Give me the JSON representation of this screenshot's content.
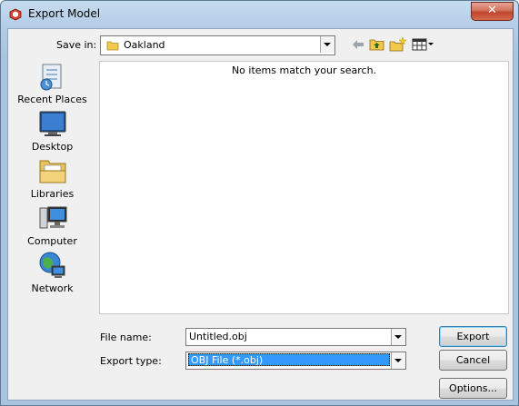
{
  "window": {
    "title": "Export Model",
    "close_glyph": "✕"
  },
  "save_in": {
    "label": "Save in:",
    "value": "Oakland"
  },
  "toolbar": {
    "back_icon": "back-arrow-icon",
    "up_icon": "up-folder-icon",
    "new_folder_icon": "new-folder-icon",
    "view_icon": "view-menu-icon"
  },
  "places": [
    {
      "label": "Recent Places",
      "icon": "recent-places-icon"
    },
    {
      "label": "Desktop",
      "icon": "desktop-icon"
    },
    {
      "label": "Libraries",
      "icon": "libraries-icon"
    },
    {
      "label": "Computer",
      "icon": "computer-icon"
    },
    {
      "label": "Network",
      "icon": "network-icon"
    }
  ],
  "file_list": {
    "empty_message": "No items match your search."
  },
  "file_name": {
    "label": "File name:",
    "value": "Untitled.obj"
  },
  "export_type": {
    "label": "Export type:",
    "value": "OBJ File (*.obj)"
  },
  "buttons": {
    "export": "Export",
    "cancel": "Cancel",
    "options": "Options..."
  },
  "colors": {
    "selection": "#3399ff",
    "close_button": "#c0452c",
    "title_bar": "#b4cde6"
  }
}
